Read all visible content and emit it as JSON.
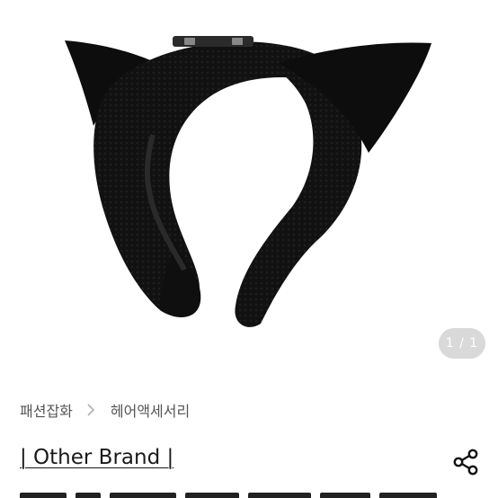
{
  "image": {
    "counter": "1 / 1",
    "alt_icon": "cat-ear-headband-photo"
  },
  "breadcrumb": {
    "items": [
      "패션잡화",
      "헤어액세서리"
    ],
    "separator_icon": "chevron-right-icon"
  },
  "product": {
    "title": "| Other Brand |"
  },
  "actions": {
    "share_icon": "share-icon"
  },
  "colors": {
    "text_primary": "#1a1a1a",
    "text_secondary": "#555555",
    "counter_bg": "#d9d9d9",
    "product_black": "#0d0d0d"
  }
}
